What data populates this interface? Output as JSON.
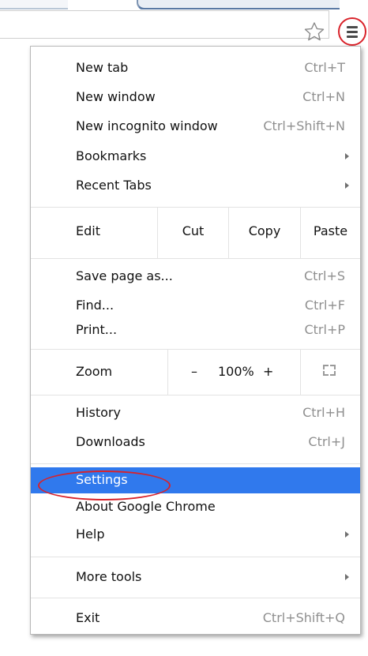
{
  "menu": {
    "items_top": [
      {
        "label": "New tab",
        "shortcut": "Ctrl+T"
      },
      {
        "label": "New window",
        "shortcut": "Ctrl+N"
      },
      {
        "label": "New incognito window",
        "shortcut": "Ctrl+Shift+N"
      },
      {
        "label": "Bookmarks",
        "submenu": true
      },
      {
        "label": "Recent Tabs",
        "submenu": true
      }
    ],
    "edit": {
      "label": "Edit",
      "cut": "Cut",
      "copy": "Copy",
      "paste": "Paste"
    },
    "items_page": [
      {
        "label": "Save page as...",
        "shortcut": "Ctrl+S"
      },
      {
        "label": "Find...",
        "shortcut": "Ctrl+F"
      },
      {
        "label": "Print...",
        "shortcut": "Ctrl+P"
      }
    ],
    "zoom": {
      "label": "Zoom",
      "decrease": "–",
      "level": "100%",
      "increase": "+"
    },
    "items_history": [
      {
        "label": "History",
        "shortcut": "Ctrl+H"
      },
      {
        "label": "Downloads",
        "shortcut": "Ctrl+J"
      }
    ],
    "items_settings": [
      {
        "label": "Settings",
        "highlighted": true
      },
      {
        "label": "About Google Chrome"
      },
      {
        "label": "Help",
        "submenu": true
      }
    ],
    "more_tools": {
      "label": "More tools",
      "submenu": true
    },
    "exit": {
      "label": "Exit",
      "shortcut": "Ctrl+Shift+Q"
    }
  },
  "toolbar": {
    "star_icon": "star-outline-icon",
    "menu_icon": "hamburger-menu-icon"
  },
  "colors": {
    "highlight": "#3079ed",
    "annotation": "#d9222a",
    "shortcut_text": "#8f8f8f"
  }
}
